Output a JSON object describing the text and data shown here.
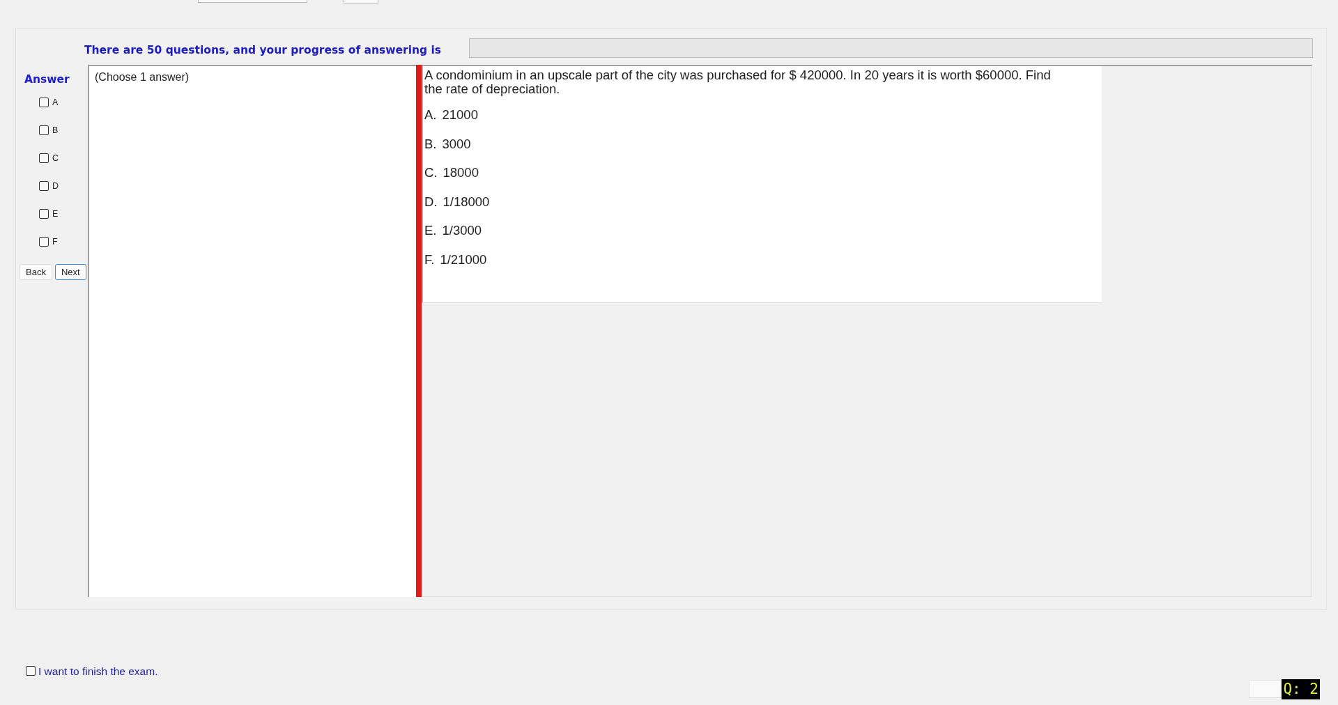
{
  "progress": {
    "label": "There are 50 questions, and your progress of answering is",
    "level": 0
  },
  "answer_panel": {
    "title": "Answer",
    "choices": [
      {
        "label": "A",
        "checked": false
      },
      {
        "label": "B",
        "checked": false
      },
      {
        "label": "C",
        "checked": false
      },
      {
        "label": "D",
        "checked": false
      },
      {
        "label": "E",
        "checked": false
      },
      {
        "label": "F",
        "checked": false
      }
    ],
    "buttons": [
      {
        "label": "Back",
        "focused": false
      },
      {
        "label": "Next",
        "focused": true
      }
    ]
  },
  "instruction": "(Choose 1 answer)",
  "question": {
    "text": "A condominium in an upscale part of the city was purchased for $ 420000. In 20 years it is worth $60000. Find the rate of depreciation.",
    "options": [
      {
        "letter": "A.",
        "text": "21000"
      },
      {
        "letter": "B.",
        "text": "3000"
      },
      {
        "letter": "C.",
        "text": "18000"
      },
      {
        "letter": "D.",
        "text": "1/18000"
      },
      {
        "letter": "E.",
        "text": "1/3000"
      },
      {
        "letter": "F.",
        "text": "1/21000"
      }
    ]
  },
  "finish": {
    "label": "I want to finish the exam.",
    "checked": false
  },
  "question_badge": "Q: 2"
}
